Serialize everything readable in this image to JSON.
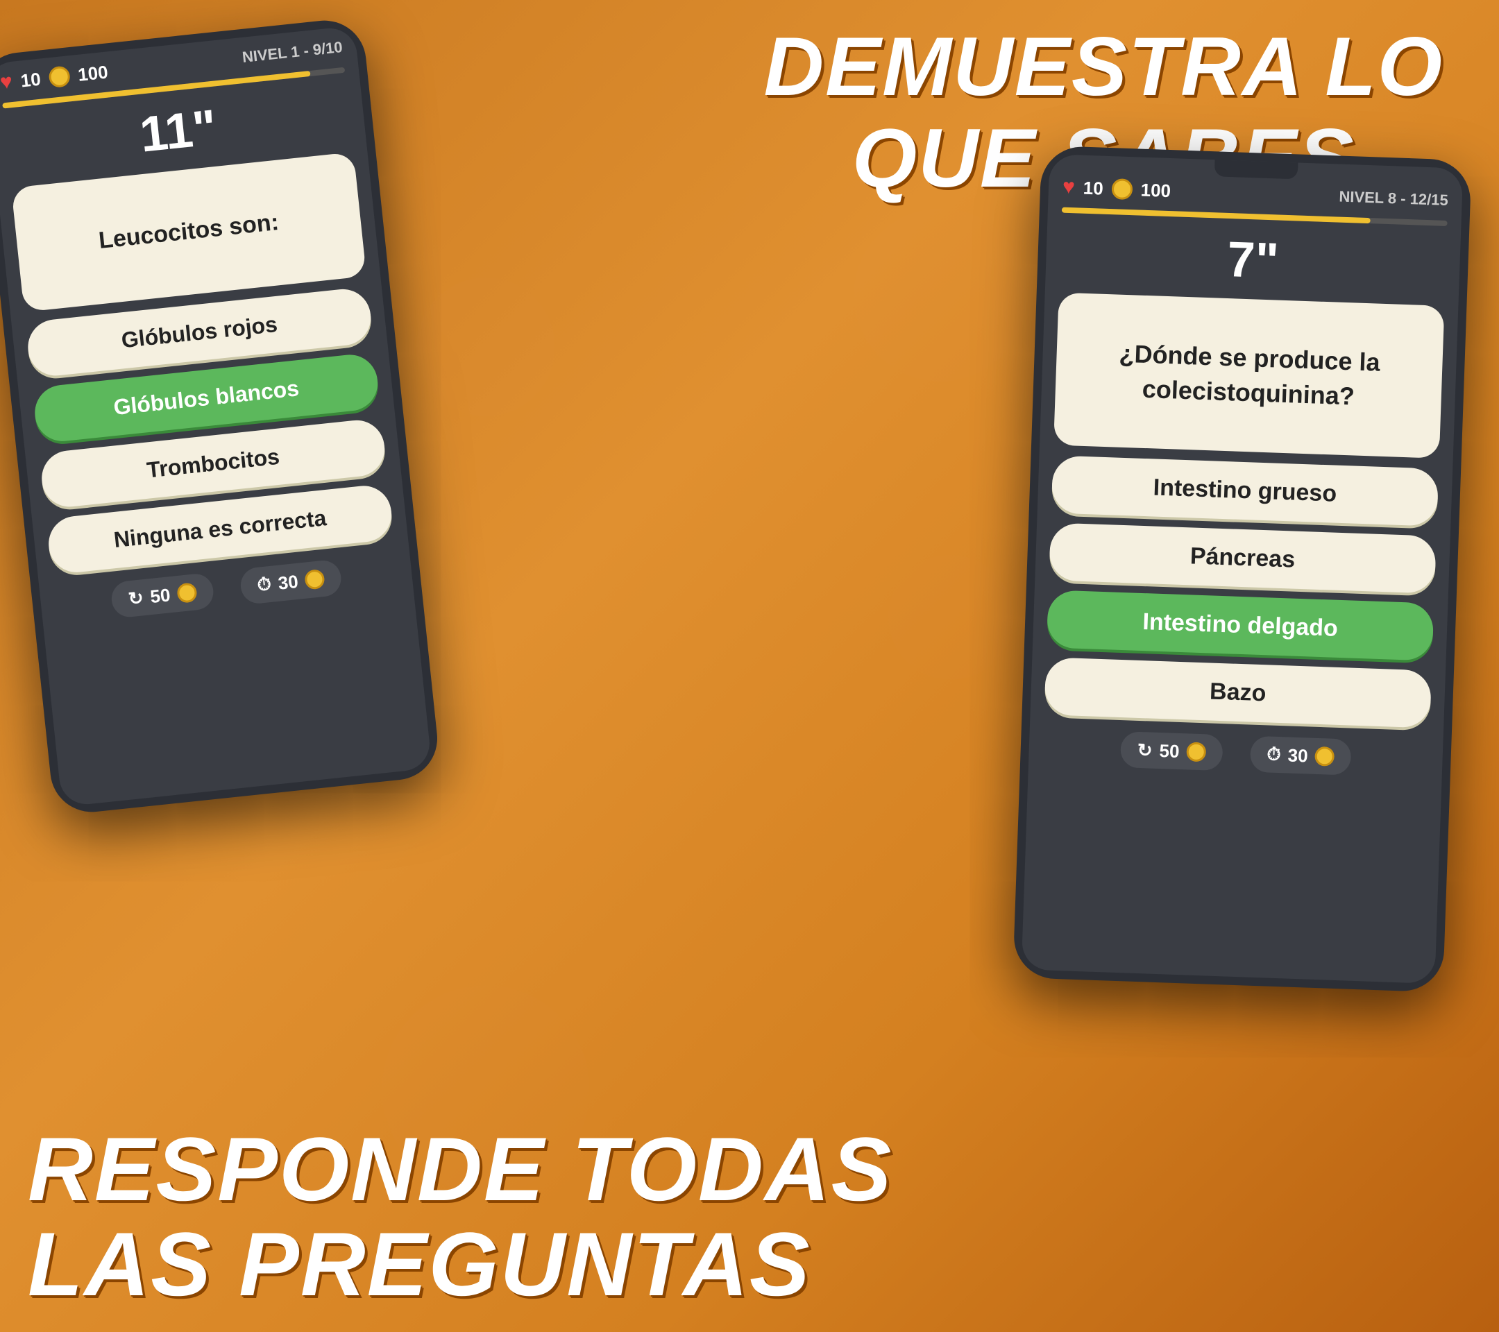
{
  "background": {
    "color": "#d48020"
  },
  "headline_top": {
    "line1": "DEMUESTRA LO",
    "line2": "QUE SABES"
  },
  "headline_bottom": {
    "line1": "RESPONDE TODAS",
    "line2": "LAS PREGUNTAS"
  },
  "phone_left": {
    "timer": "11\"",
    "level": "NIVEL 1 - 9/10",
    "hearts": "10",
    "coins": "100",
    "progress": "90",
    "question": "Leucocitos son:",
    "answers": [
      {
        "text": "Glóbulos rojos",
        "correct": false
      },
      {
        "text": "Glóbulos blancos",
        "correct": true
      },
      {
        "text": "Trombocitos",
        "correct": false
      },
      {
        "text": "Ninguna es correcta",
        "correct": false
      }
    ],
    "powerup1_cost": "50",
    "powerup2_cost": "30"
  },
  "phone_right": {
    "timer": "7\"",
    "level": "NIVEL 8 - 12/15",
    "hearts": "10",
    "coins": "100",
    "progress": "80",
    "question": "¿Dónde se produce la colecistoquinina?",
    "answers": [
      {
        "text": "Intestino grueso",
        "correct": false
      },
      {
        "text": "Páncreas",
        "correct": false
      },
      {
        "text": "Intestino delgado",
        "correct": true
      },
      {
        "text": "Bazo",
        "correct": false
      }
    ],
    "powerup1_cost": "50",
    "powerup2_cost": "30"
  }
}
